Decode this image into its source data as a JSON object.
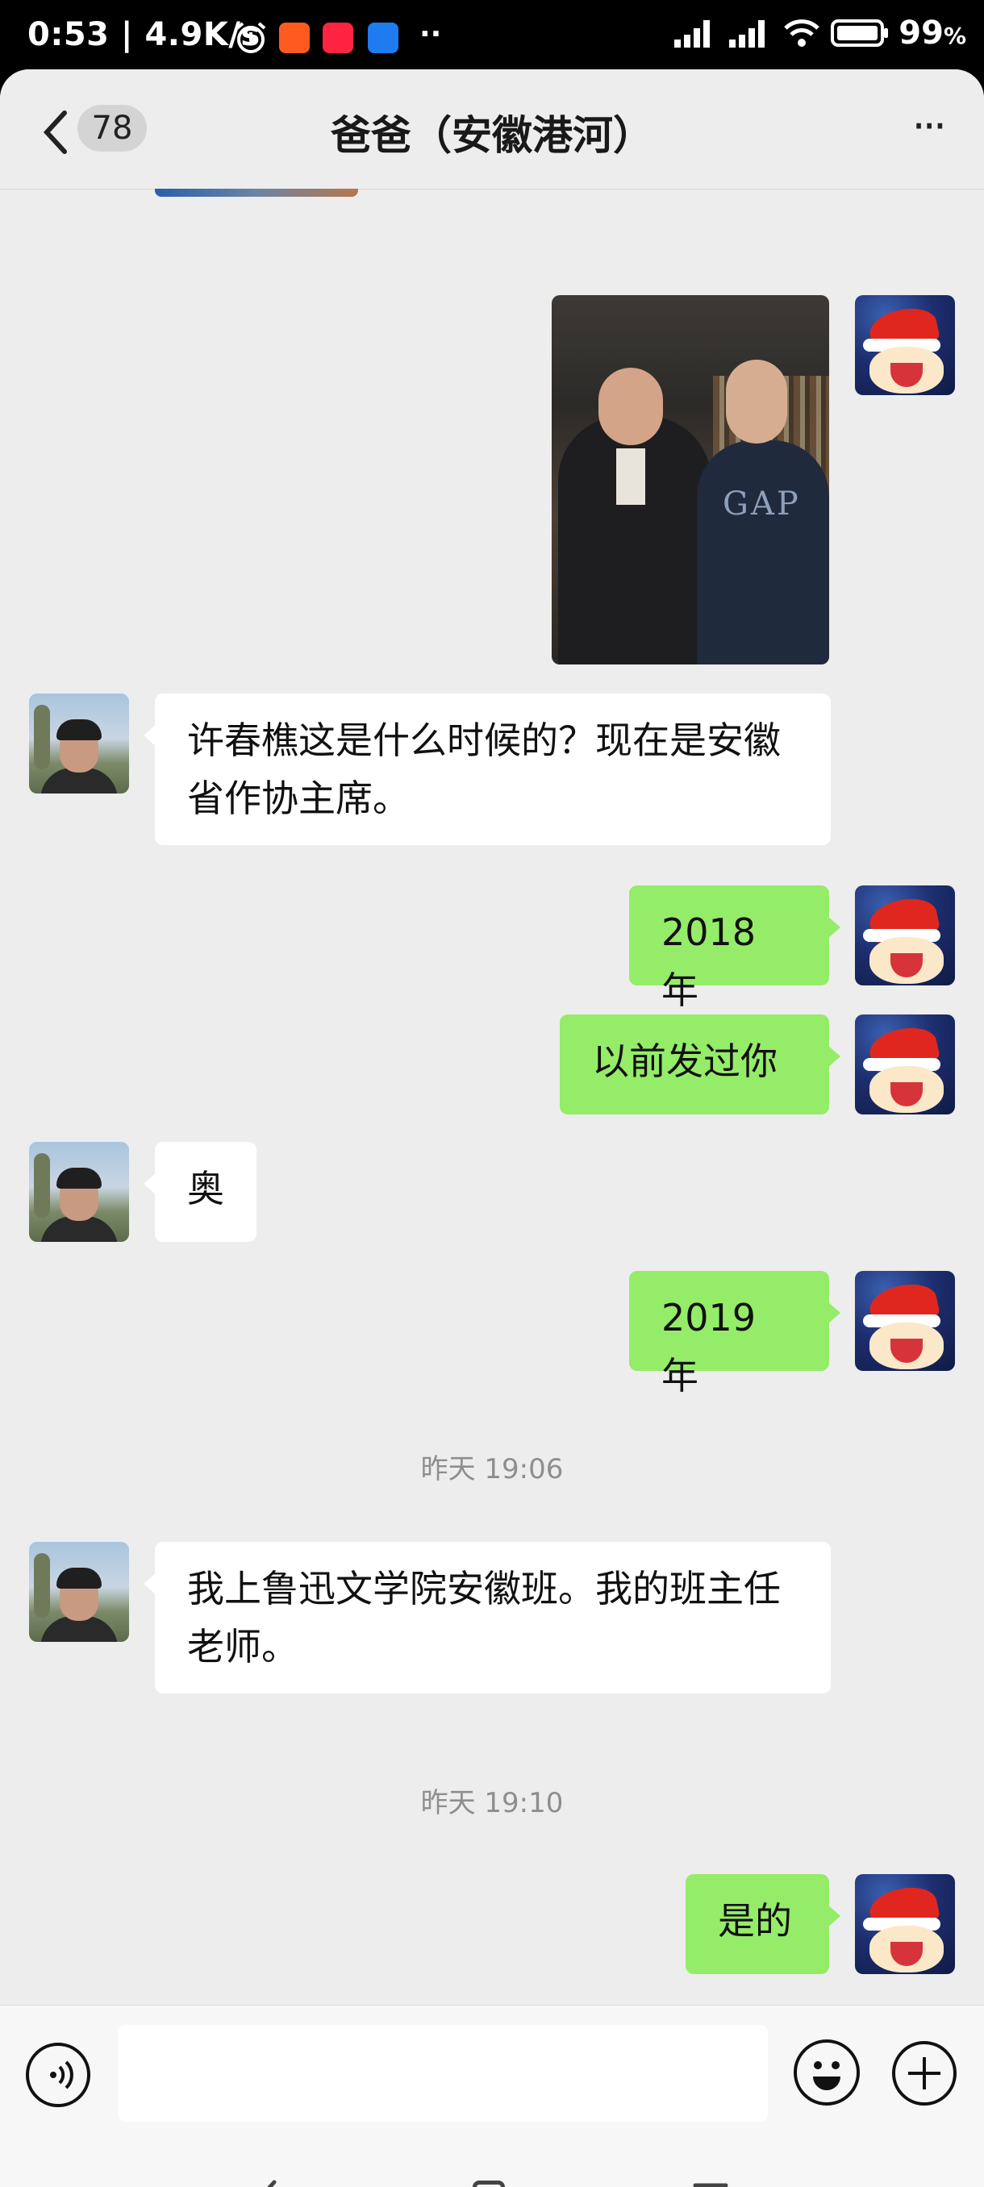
{
  "status_bar": {
    "time": "0:53",
    "network_speed": "4.9K/s",
    "battery": "99",
    "battery_unit": "%",
    "more": "··"
  },
  "header": {
    "back_count": "78",
    "title": "爸爸（安徽港河）",
    "more": "···"
  },
  "messages": [
    {
      "side": "in",
      "text": "许春樵这是什么时候的？现在是安徽省作协主席。"
    },
    {
      "side": "out",
      "text": "2018 年"
    },
    {
      "side": "out",
      "text": "以前发过你"
    },
    {
      "side": "in",
      "text": "奥"
    },
    {
      "side": "out",
      "text": "2019 年"
    },
    {
      "side": "in",
      "text": "我上鲁迅文学院安徽班。我的班主任老师。"
    },
    {
      "side": "out",
      "text": "是的"
    }
  ],
  "timestamps": [
    "昨天 19:06",
    "昨天 19:10"
  ],
  "photo": {
    "shirt_text": "GAP"
  },
  "icons": {
    "back": "chevron-left-icon",
    "more": "more-dots-icon",
    "voice": "voice-icon",
    "emoji": "emoji-icon",
    "plus": "plus-icon"
  },
  "colors": {
    "outgoing_bubble": "#95ec69",
    "incoming_bubble": "#ffffff",
    "chat_bg": "#ededed"
  }
}
